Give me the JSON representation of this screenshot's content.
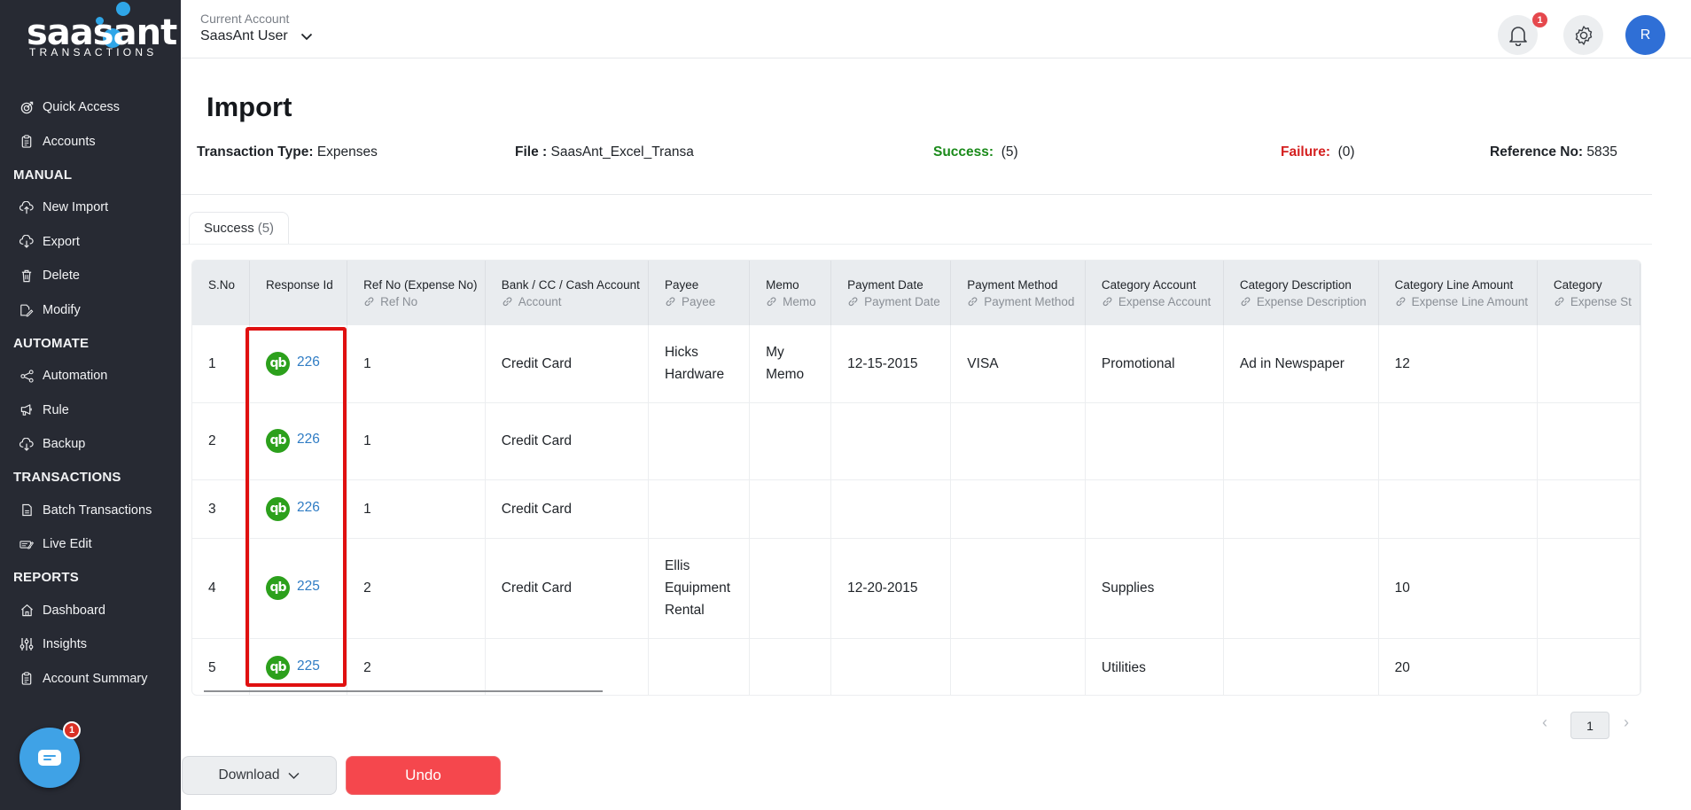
{
  "brand": {
    "wordmark": "saasant",
    "subtitle": "TRANSACTIONS",
    "accent": "#2fa6e8"
  },
  "sidebar": {
    "items": [
      {
        "type": "item",
        "label": "Quick Access",
        "icon": "target-icon"
      },
      {
        "type": "item",
        "label": "Accounts",
        "icon": "clipboard-icon"
      },
      {
        "type": "section",
        "label": "MANUAL"
      },
      {
        "type": "item",
        "label": "New Import",
        "icon": "cloud-upload-icon"
      },
      {
        "type": "item",
        "label": "Export",
        "icon": "cloud-download-icon"
      },
      {
        "type": "item",
        "label": "Delete",
        "icon": "trash-icon"
      },
      {
        "type": "item",
        "label": "Modify",
        "icon": "file-edit-icon"
      },
      {
        "type": "section",
        "label": "AUTOMATE"
      },
      {
        "type": "item",
        "label": "Automation",
        "icon": "share-nodes-icon"
      },
      {
        "type": "item",
        "label": "Rule",
        "icon": "megaphone-icon"
      },
      {
        "type": "item",
        "label": "Backup",
        "icon": "cloud-download-icon"
      },
      {
        "type": "section",
        "label": "TRANSACTIONS"
      },
      {
        "type": "item",
        "label": "Batch Transactions",
        "icon": "document-icon"
      },
      {
        "type": "item",
        "label": "Live Edit",
        "icon": "edit-card-icon"
      },
      {
        "type": "section",
        "label": "REPORTS"
      },
      {
        "type": "item",
        "label": "Dashboard",
        "icon": "home-icon"
      },
      {
        "type": "item",
        "label": "Insights",
        "icon": "sliders-icon"
      },
      {
        "type": "item",
        "label": "Account Summary",
        "icon": "clipboard-icon"
      }
    ],
    "chat_badge": "1"
  },
  "header": {
    "account_label": "Current Account",
    "account_name": "SaasAnt User",
    "notification_count": "1",
    "avatar_initial": "R"
  },
  "page": {
    "title": "Import",
    "transaction_type_label": "Transaction Type:",
    "transaction_type": "Expenses",
    "file_label": "File :",
    "file": "SaasAnt_Excel_Transa",
    "success_label": "Success:",
    "success_count": "(5)",
    "failure_label": "Failure:",
    "failure_count": "(0)",
    "reference_label": "Reference No:",
    "reference_no": "5835",
    "colors": {
      "success": "#1a8a1a",
      "failure": "#d42020",
      "link": "#2f7cc4",
      "undo": "#f5474d"
    }
  },
  "tabs": [
    {
      "label": "Success",
      "count": "(5)"
    }
  ],
  "table": {
    "columns": [
      {
        "title": "S.No",
        "mapped": ""
      },
      {
        "title": "Response Id",
        "mapped": ""
      },
      {
        "title": "Ref No (Expense No)",
        "mapped": "Ref No"
      },
      {
        "title": "Bank / CC / Cash Account",
        "mapped": "Account"
      },
      {
        "title": "Payee",
        "mapped": "Payee"
      },
      {
        "title": "Memo",
        "mapped": "Memo"
      },
      {
        "title": "Payment Date",
        "mapped": "Payment Date"
      },
      {
        "title": "Payment Method",
        "mapped": "Payment Method"
      },
      {
        "title": "Category Account",
        "mapped": "Expense Account"
      },
      {
        "title": "Category Description",
        "mapped": "Expense Description"
      },
      {
        "title": "Category Line Amount",
        "mapped": "Expense Line Amount"
      },
      {
        "title": "Category",
        "mapped": "Expense St"
      }
    ],
    "rows": [
      {
        "sno": "1",
        "response_id": "226",
        "ref_no": "1",
        "account": "Credit Card",
        "payee": "Hicks Hardware",
        "memo": "My Memo",
        "payment_date": "12-15-2015",
        "payment_method": "VISA",
        "category_account": "Promotional",
        "category_description": "Ad in Newspaper",
        "line_amount": "12",
        "category_extra": ""
      },
      {
        "sno": "2",
        "response_id": "226",
        "ref_no": "1",
        "account": "Credit Card",
        "payee": "",
        "memo": "",
        "payment_date": "",
        "payment_method": "",
        "category_account": "",
        "category_description": "",
        "line_amount": "",
        "category_extra": ""
      },
      {
        "sno": "3",
        "response_id": "226",
        "ref_no": "1",
        "account": "Credit Card",
        "payee": "",
        "memo": "",
        "payment_date": "",
        "payment_method": "",
        "category_account": "",
        "category_description": "",
        "line_amount": "",
        "category_extra": ""
      },
      {
        "sno": "4",
        "response_id": "225",
        "ref_no": "2",
        "account": "Credit Card",
        "payee": "Ellis Equipment Rental",
        "memo": "",
        "payment_date": "12-20-2015",
        "payment_method": "",
        "category_account": "Supplies",
        "category_description": "",
        "line_amount": "10",
        "category_extra": ""
      },
      {
        "sno": "5",
        "response_id": "225",
        "ref_no": "2",
        "account": "",
        "payee": "",
        "memo": "",
        "payment_date": "",
        "payment_method": "",
        "category_account": "Utilities",
        "category_description": "",
        "line_amount": "20",
        "category_extra": ""
      }
    ],
    "qb_logo_text": "qb"
  },
  "pagination": {
    "prev": "‹",
    "current": "1",
    "next": "›"
  },
  "actions": {
    "download_label": "Download",
    "undo_label": "Undo"
  }
}
